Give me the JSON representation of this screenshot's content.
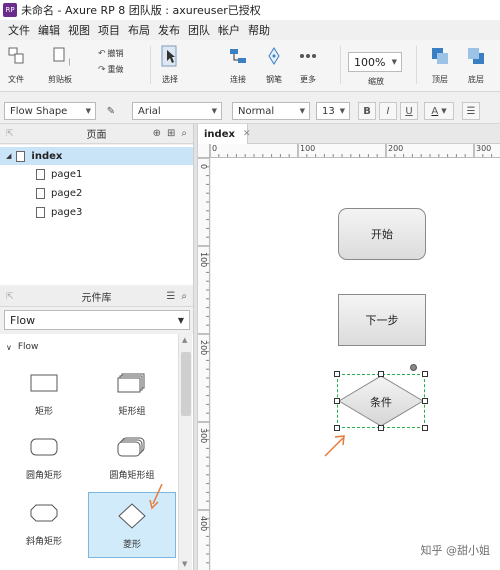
{
  "window": {
    "title": "未命名 - Axure RP 8 团队版 : axureuser已授权",
    "logo_text": "RP"
  },
  "menu": [
    "文件",
    "编辑",
    "视图",
    "项目",
    "布局",
    "发布",
    "团队",
    "帐户",
    "帮助"
  ],
  "toolbar": {
    "file_label": "文件",
    "clipboard_label": "剪贴板",
    "undo_label": "撤销",
    "redo_label": "重做",
    "select_label": "选择",
    "connect_label": "连接",
    "pen_label": "钢笔",
    "more_label": "更多",
    "zoom_value": "100%",
    "zoom_label": "缩放",
    "top_label": "顶层",
    "bottom_label": "底层"
  },
  "format": {
    "style": "Flow Shape",
    "font": "Arial",
    "weight": "Normal",
    "size": "13",
    "bold": "B",
    "italic": "I",
    "underline": "U",
    "font_color_glyph": "A"
  },
  "pages_panel": {
    "title": "页面",
    "items": [
      {
        "label": "index",
        "level": 0
      },
      {
        "label": "page1",
        "level": 1
      },
      {
        "label": "page2",
        "level": 1
      },
      {
        "label": "page3",
        "level": 1
      }
    ]
  },
  "library_panel": {
    "title": "元件库",
    "selected_library": "Flow",
    "category": "Flow",
    "widgets": [
      "矩形",
      "矩形组",
      "圆角矩形",
      "圆角矩形组",
      "斜角矩形",
      "菱形"
    ]
  },
  "canvas": {
    "tab": "index",
    "ruler_h": [
      "0",
      "100",
      "200",
      "300"
    ],
    "ruler_v": [
      "0",
      "100",
      "200",
      "300",
      "400"
    ],
    "shapes": {
      "start": "开始",
      "next": "下一步",
      "condition": "条件"
    }
  },
  "colors": {
    "accent_select": "#c9e3f7",
    "selection_green": "#22b14c",
    "annotation_arrow": "#e8793a",
    "logo": "#6b2d8c"
  },
  "watermark": "知乎 @甜小姐"
}
